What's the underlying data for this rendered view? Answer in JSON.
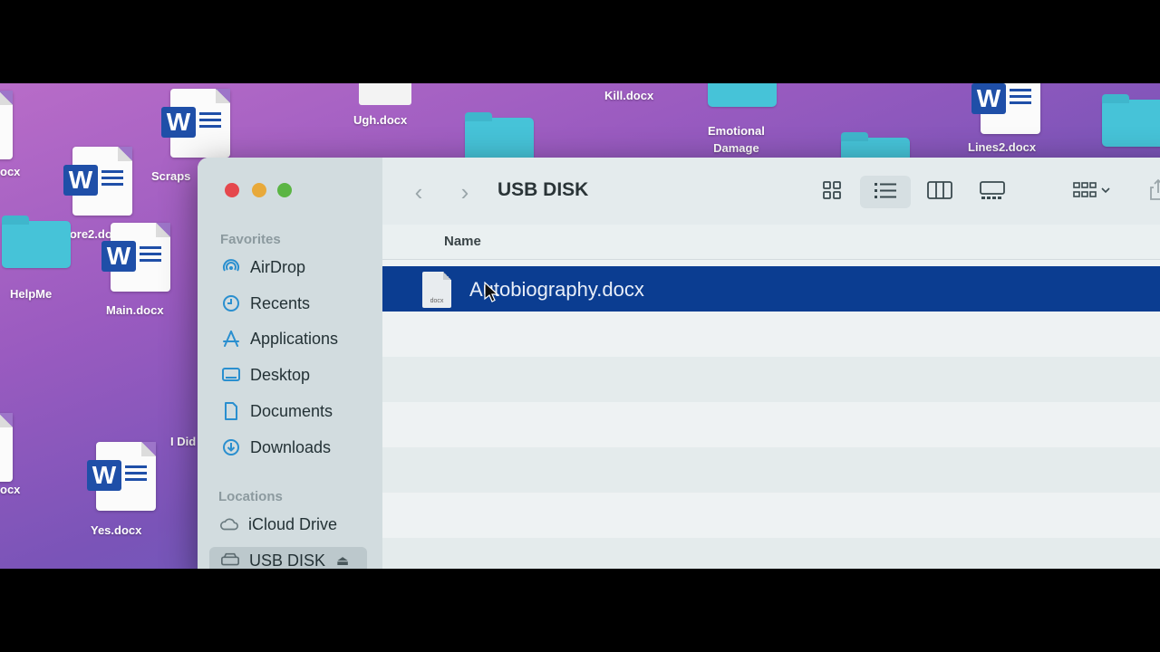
{
  "desktop": {
    "icons": {
      "ocx_top": "ocx",
      "scraps": "Scraps",
      "more2": "More2.docx",
      "helpme": "HelpMe",
      "main": "Main.docx",
      "ugh": "Ugh.docx",
      "kill": "Kill.docx",
      "emotional": "Emotional\nDamage",
      "lines2": "Lines2.docx",
      "idid": "I Did",
      "ocx_bottom": "ocx",
      "yes": "Yes.docx"
    }
  },
  "window": {
    "title": "USB DISK",
    "toolbar": {
      "back": "‹",
      "forward": "›",
      "icons_view": "icons-view-icon",
      "list_view": "list-view-icon",
      "columns_view": "columns-view-icon",
      "gallery_view": "gallery-view-icon",
      "group_by": "group-icon",
      "share": "share-icon"
    },
    "sidebar": {
      "favorites_title": "Favorites",
      "favorites": [
        {
          "label": "AirDrop",
          "icon": "airdrop-icon"
        },
        {
          "label": "Recents",
          "icon": "clock-icon"
        },
        {
          "label": "Applications",
          "icon": "applications-icon"
        },
        {
          "label": "Desktop",
          "icon": "desktop-icon"
        },
        {
          "label": "Documents",
          "icon": "document-icon"
        },
        {
          "label": "Downloads",
          "icon": "download-icon"
        }
      ],
      "locations_title": "Locations",
      "locations": [
        {
          "label": "iCloud Drive",
          "icon": "cloud-icon"
        },
        {
          "label": "USB DISK",
          "icon": "drive-icon",
          "eject": "⏏"
        }
      ]
    },
    "list": {
      "column_name": "Name",
      "files": [
        {
          "name": "Autobiography.docx",
          "badge": "docx",
          "selected": true
        }
      ]
    }
  },
  "colors": {
    "selection": "#0b3d91",
    "accent": "#2a8fcf",
    "close": "#e5484d",
    "minimize": "#e8a93a",
    "zoom": "#5bb544"
  }
}
